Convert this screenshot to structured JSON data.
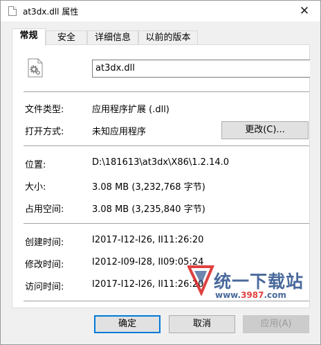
{
  "window": {
    "title": "at3dx.dll 属性",
    "close_glyph": "✕"
  },
  "tabs": [
    {
      "label": "常规",
      "active": true
    },
    {
      "label": "安全",
      "active": false
    },
    {
      "label": "详细信息",
      "active": false
    },
    {
      "label": "以前的版本",
      "active": false
    }
  ],
  "general": {
    "file_name": "at3dx.dll",
    "file_type_label": "文件类型:",
    "file_type_value": "应用程序扩展 (.dll)",
    "open_with_label": "打开方式:",
    "open_with_value": "未知应用程序",
    "change_button": "更改(C)...",
    "location_label": "位置:",
    "location_value": "D:\\181613\\at3dx\\X86\\1.2.14.0",
    "size_label": "大小:",
    "size_value": "3.08 MB (3,232,768 字节)",
    "size_on_disk_label": "占用空间:",
    "size_on_disk_value": "3.08 MB (3,235,840 字节)",
    "created_label": "创建时间:",
    "created_value": "I2017-I12-I26, II11:26:20",
    "modified_label": "修改时间:",
    "modified_value": "I2012-I09-I28, II09:05:24",
    "accessed_label": "访问时间:",
    "accessed_value": "I2017-I12-I26, II11:26:20"
  },
  "buttons": {
    "ok": "确定",
    "cancel": "取消",
    "apply": "应用(A)"
  },
  "watermark": {
    "brand": "统一下载站",
    "url_prefix": "www.",
    "url_number": "3987",
    "url_suffix": ".com",
    "colors": {
      "blue": "#2a4f8a",
      "red": "#d9201f"
    }
  }
}
